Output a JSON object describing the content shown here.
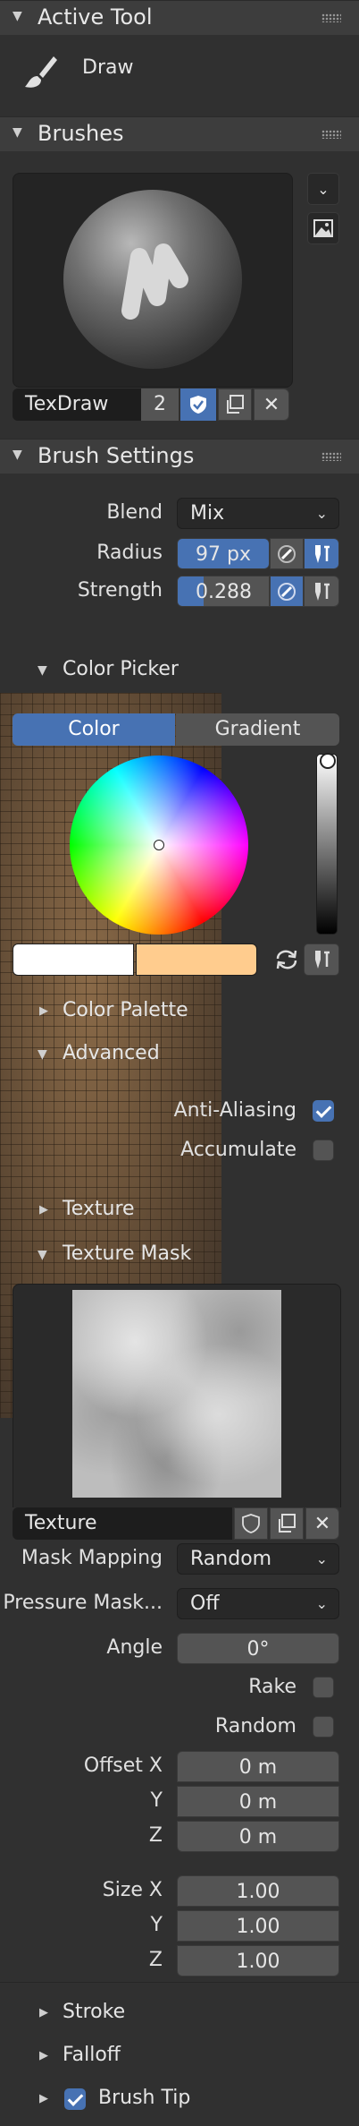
{
  "active_tool": {
    "header": "Active Tool",
    "tool_name": "Draw"
  },
  "brushes": {
    "header": "Brushes",
    "brush_name": "TexDraw",
    "user_count": "2"
  },
  "brush_settings": {
    "header": "Brush Settings",
    "blend_label": "Blend",
    "blend_value": "Mix",
    "radius_label": "Radius",
    "radius_value": "97 px",
    "strength_label": "Strength",
    "strength_value": "0.288",
    "strength_fraction": 0.288
  },
  "color_picker": {
    "header": "Color Picker",
    "tab_color": "Color",
    "tab_gradient": "Gradient",
    "primary_color": "#ffffff",
    "secondary_color": "#ffcc8e"
  },
  "color_palette": {
    "header": "Color Palette"
  },
  "advanced": {
    "header": "Advanced",
    "anti_aliasing_label": "Anti-Aliasing",
    "anti_aliasing_checked": true,
    "accumulate_label": "Accumulate",
    "accumulate_checked": false
  },
  "texture": {
    "header": "Texture"
  },
  "texture_mask": {
    "header": "Texture Mask",
    "texture_name": "Texture",
    "mask_mapping_label": "Mask Mapping",
    "mask_mapping_value": "Random",
    "pressure_mask_label": "Pressure Mask...",
    "pressure_mask_value": "Off",
    "angle_label": "Angle",
    "angle_value": "0°",
    "rake_label": "Rake",
    "random_label": "Random",
    "offset_x_label": "Offset X",
    "offset_x": "0 m",
    "offset_y_label": "Y",
    "offset_y": "0 m",
    "offset_z_label": "Z",
    "offset_z": "0 m",
    "size_x_label": "Size X",
    "size_x": "1.00",
    "size_y_label": "Y",
    "size_y": "1.00",
    "size_z_label": "Z",
    "size_z": "1.00"
  },
  "stroke": {
    "header": "Stroke"
  },
  "falloff": {
    "header": "Falloff"
  },
  "brush_tip": {
    "header": "Brush Tip",
    "checked": true
  },
  "colors": {
    "accent": "#4772b3",
    "panel_bg": "#303030",
    "header_bg": "#3d3d3d",
    "field_bg": "#545454"
  }
}
